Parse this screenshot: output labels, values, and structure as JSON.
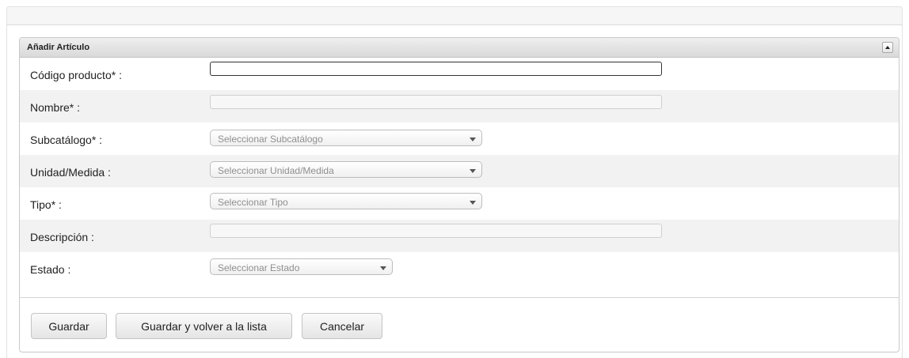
{
  "panel": {
    "title": "Añadir Artículo"
  },
  "form": {
    "codigo_label": "Código producto* :",
    "codigo_value": "",
    "nombre_label": "Nombre* :",
    "nombre_value": "",
    "subcatalogo_label": "Subcatálogo* :",
    "subcatalogo_placeholder": "Seleccionar Subcatálogo",
    "unidad_label": "Unidad/Medida :",
    "unidad_placeholder": "Seleccionar Unidad/Medida",
    "tipo_label": "Tipo* :",
    "tipo_placeholder": "Seleccionar Tipo",
    "descripcion_label": "Descripción :",
    "descripcion_value": "",
    "estado_label": "Estado :",
    "estado_placeholder": "Seleccionar Estado"
  },
  "buttons": {
    "guardar": "Guardar",
    "guardar_volver": "Guardar y volver a la lista",
    "cancelar": "Cancelar"
  }
}
